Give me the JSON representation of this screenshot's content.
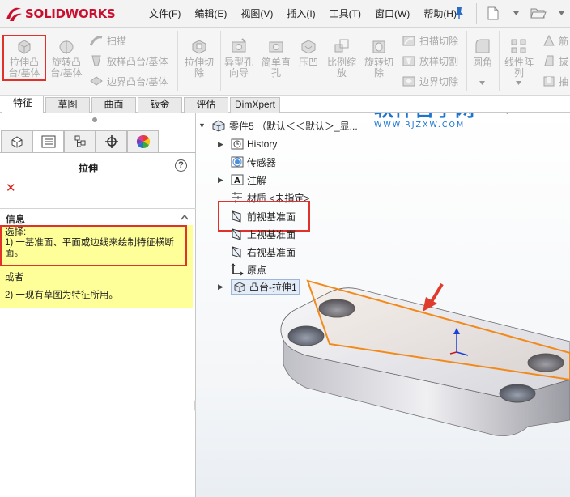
{
  "app": {
    "brand_ds": "3S",
    "brand_name": "SOLIDWORKS"
  },
  "menu": [
    "文件(F)",
    "编辑(E)",
    "视图(V)",
    "插入(I)",
    "工具(T)",
    "窗口(W)",
    "帮助(H)"
  ],
  "ribbon": {
    "extrude_boss": "拉伸凸\n台/基体",
    "revolve_boss": "旋转凸\n台/基体",
    "sweep": "扫描",
    "loft_boss": "放样凸台/基体",
    "boundary_boss": "边界凸台/基体",
    "extrude_cut": "拉伸切\n除",
    "hole_wizard": "异型孔\n向导",
    "simple_hole": "简单直\n孔",
    "indent": "压凹",
    "scale": "比例缩\n放",
    "revolve_cut": "旋转切\n除",
    "swept_cut": "扫描切除",
    "lofted_cut": "放样切割",
    "boundary_cut": "边界切除",
    "fillet": "圆角",
    "linear_pattern": "线性阵\n列",
    "rib": "筋",
    "draft": "拔",
    "shell": "抽"
  },
  "tabs": [
    "特征",
    "草图",
    "曲面",
    "钣金",
    "评估",
    "DimXpert"
  ],
  "panel": {
    "title": "拉伸",
    "help": "?",
    "cancel": "✕",
    "section_title": "信息",
    "msg_line1": "选择:",
    "msg_line2": "1) 一基准面、平面或边线来绘制特征横断",
    "msg_line3": "面。",
    "msg_line4": "或者",
    "msg_line5": "2) 一现有草图为特征所用。"
  },
  "watermark": {
    "big": "软件自学网",
    "small": "WWW.RJZXW.COM"
  },
  "tree": {
    "root": "零件5 （默认＜＜默认＞_显...",
    "history": "History",
    "sensors": "传感器",
    "annotations": "注解",
    "material": "材质 <未指定>",
    "front_plane": "前视基准面",
    "top_plane": "上视基准面",
    "right_plane": "右视基准面",
    "origin": "原点",
    "boss_extrude": "凸台-拉伸1"
  },
  "colors": {
    "highlight": "#e0312b",
    "plane_edge": "#f28a1b",
    "brand": "#c8102e",
    "watermark": "#1b74d1",
    "message_bg": "#ffff99"
  }
}
